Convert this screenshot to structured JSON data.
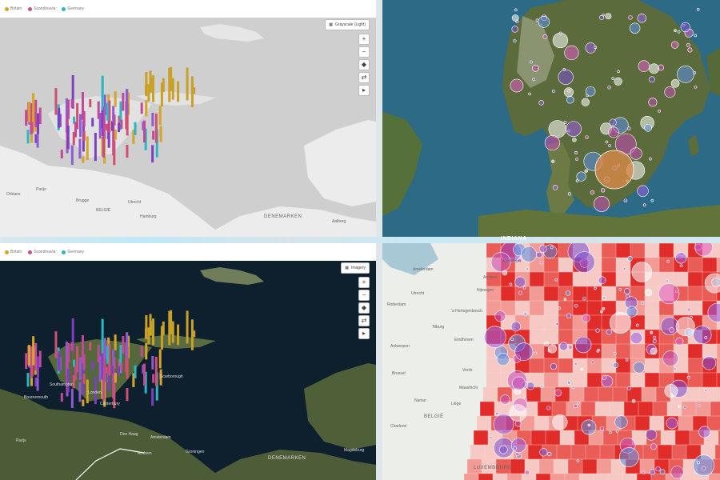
{
  "panels": {
    "top_left": {
      "legend": [
        {
          "label": "Britain",
          "color": "#d4a52a"
        },
        {
          "label": "Scandinavia",
          "color": "#c94f8a"
        },
        {
          "label": "Germany",
          "color": "#2bb6c4"
        }
      ],
      "basemap_label": "Grayscale (Light)",
      "controls": [
        "+",
        "−",
        "◆",
        "⇄",
        "▸"
      ],
      "place_labels": {
        "paris": "Parijs",
        "orleans": "Orléans",
        "belgie": "BELGIË",
        "denemarken": "DENEMARKEN",
        "aalborg": "Aalborg",
        "hamburg": "Hamburg",
        "utrecht": "Utrecht",
        "brugge": "Brugge"
      }
    },
    "top_right": {
      "strip_label": "INDIANA"
    },
    "bottom_left": {
      "legend": [
        {
          "label": "Britain",
          "color": "#d4a52a"
        },
        {
          "label": "Scandinavia",
          "color": "#c94f8a"
        },
        {
          "label": "Germany",
          "color": "#2bb6c4"
        }
      ],
      "basemap_label": "Imagery",
      "controls": [
        "+",
        "−",
        "◆",
        "⇄",
        "▸"
      ],
      "place_labels": {
        "london": "Londen",
        "southampton": "Southampton",
        "canterbury": "Canterbury",
        "paris": "Parijs",
        "denhaag": "Den Haag",
        "amsterdam": "Amsterdam",
        "groningen": "Groningen",
        "arnhem": "Arnhem",
        "denemarken": "DENEMARKEN",
        "bournemouth": "Bournemouth",
        "scarborough": "Scarborough",
        "magdeburg": "Magdeburg"
      }
    },
    "bottom_right": {
      "place_labels": {
        "amsterdam": "Amsterdam",
        "utrecht": "Utrecht",
        "tilburg": "Tilburg",
        "antwerpen": "Antwerpen",
        "brussel": "Brussel",
        "belgie": "BELGIË",
        "luxembourg": "LUXEMBOURG",
        "nijmegen": "Nijmegen",
        "eindhoven": "Eindhoven",
        "charleroi": "Charleroi",
        "hertogenbosch": "'s-Hertogenbosch",
        "apeldoorn": "Apeldoorn",
        "arnhem": "Arnhem",
        "liege": "Liège",
        "namur": "Namur",
        "rotterdam": "Rotterdam",
        "maastricht": "Maastricht",
        "venlo": "Venlo"
      }
    }
  },
  "colors": {
    "bar_palette": [
      "#c2489a",
      "#8e5bd0",
      "#d4a52a",
      "#2bb6c4",
      "#d04f72",
      "#7d3fbf"
    ],
    "choropleth": [
      "#f7c9c4",
      "#f29a93",
      "#ea5c56",
      "#e12d2a"
    ]
  }
}
